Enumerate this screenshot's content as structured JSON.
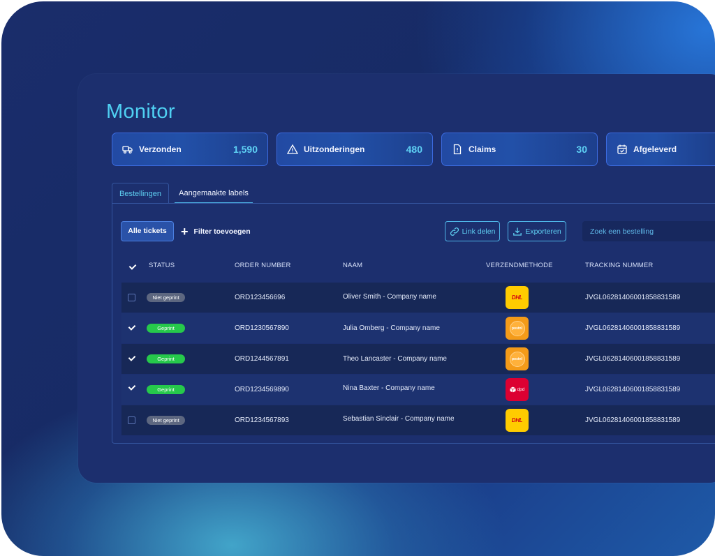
{
  "page": {
    "title": "Monitor"
  },
  "stats": [
    {
      "label": "Verzonden",
      "value": "1,590",
      "icon": "truck-icon"
    },
    {
      "label": "Uitzonderingen",
      "value": "480",
      "icon": "warning-icon"
    },
    {
      "label": "Claims",
      "value": "30",
      "icon": "document-icon"
    },
    {
      "label": "Afgeleverd",
      "value": "",
      "icon": "calendar-check-icon"
    }
  ],
  "tabs": [
    {
      "label": "Bestellingen"
    },
    {
      "label": "Aangemaakte labels"
    }
  ],
  "toolbar": {
    "all_tickets": "Alle tickets",
    "add_filter": "Filter toevoegen",
    "share_link": "Link delen",
    "export": "Exporteren",
    "search_placeholder": "Zoek een bestelling"
  },
  "table": {
    "headers": {
      "status": "STATUS",
      "order_number": "ORDER NUMBER",
      "name": "NAAM",
      "shipping_method": "VERZENDMETHODE",
      "tracking": "TRACKING NUMMER"
    },
    "rows": [
      {
        "checked": false,
        "status": "Niet geprint",
        "order": "ORD123456696",
        "name": "Oliver Smith - Company name",
        "carrier": "DHL",
        "tracking": "JVGL06281406001858831589"
      },
      {
        "checked": true,
        "status": "Geprint",
        "order": "ORD1230567890",
        "name": "Julia Omberg - Company name",
        "carrier": "postnl",
        "tracking": "JVGL06281406001858831589"
      },
      {
        "checked": true,
        "status": "Geprint",
        "order": "ORD1244567891",
        "name": "Theo Lancaster - Company name",
        "carrier": "postnl",
        "tracking": "JVGL06281406001858831589"
      },
      {
        "checked": true,
        "status": "Geprint",
        "order": "ORD1234569890",
        "name": "Nina Baxter - Company name",
        "carrier": "dpd",
        "tracking": "JVGL06281406001858831589"
      },
      {
        "checked": false,
        "status": "Niet geprint",
        "order": "ORD1234567893",
        "name": "Sebastian Sinclair - Company name",
        "carrier": "DHL",
        "tracking": "JVGL06281406001858831589"
      }
    ]
  },
  "colors": {
    "accent": "#4fd0f2",
    "panel": "#1c2f6e",
    "printed": "#26c94b",
    "not_printed": "#5d6780"
  }
}
